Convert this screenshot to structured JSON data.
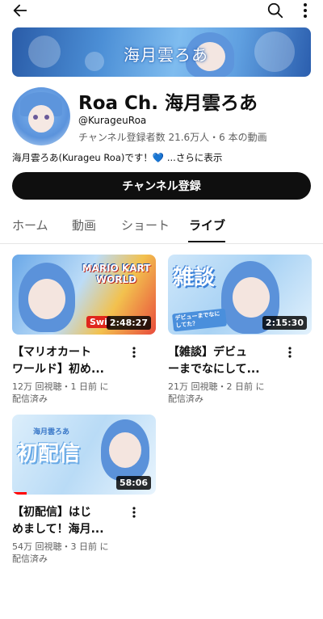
{
  "topbar": {
    "back_icon": "arrow-left-icon",
    "search_icon": "search-icon",
    "more_icon": "more-vert-icon"
  },
  "banner": {
    "text": "海月雲ろあ"
  },
  "channel": {
    "name": "Roa Ch. 海月雲ろあ",
    "handle": "@KurageuRoa",
    "stats": "チャンネル登録者数 21.6万人・6 本の動画",
    "description": "海月雲ろあ(Kurageu Roa)です！",
    "description_more": " ...さらに表示",
    "heart": "💙"
  },
  "subscribe_label": "チャンネル登録",
  "tabs": [
    {
      "label": "ホーム",
      "active": false
    },
    {
      "label": "動画",
      "active": false
    },
    {
      "label": "ショート",
      "active": false
    },
    {
      "label": "ライブ",
      "active": true
    }
  ],
  "videos": [
    {
      "title_line1": "【マリオカート",
      "title_line2": "ワールド】初め...",
      "duration": "2:48:27",
      "meta_line1": "12万 回視聴・1 日前 に",
      "meta_line2": "配信済み",
      "thumb_text": "MARIO KART WORLD",
      "thumb_badge": "Swi"
    },
    {
      "title_line1": "【雑談】デビュ",
      "title_line2": "ーまでなにして...",
      "duration": "2:15:30",
      "meta_line1": "21万 回視聴・2 日前 に",
      "meta_line2": "配信済み",
      "thumb_text": "雑談",
      "thumb_badge": "デビューまでなにしてた？"
    },
    {
      "title_line1": "【初配信】はじ",
      "title_line2": "めまして！海月...",
      "duration": "58:06",
      "meta_line1": "54万 回視聴・3 日前 に",
      "meta_line2": "配信済み",
      "thumb_text": "初配信",
      "thumb_badge": "海月雲ろあ",
      "watch_progress": 0.1
    }
  ],
  "colors": {
    "accent": "#0f0f0f",
    "secondary_text": "#606060",
    "heart": "#3b7fd9"
  }
}
